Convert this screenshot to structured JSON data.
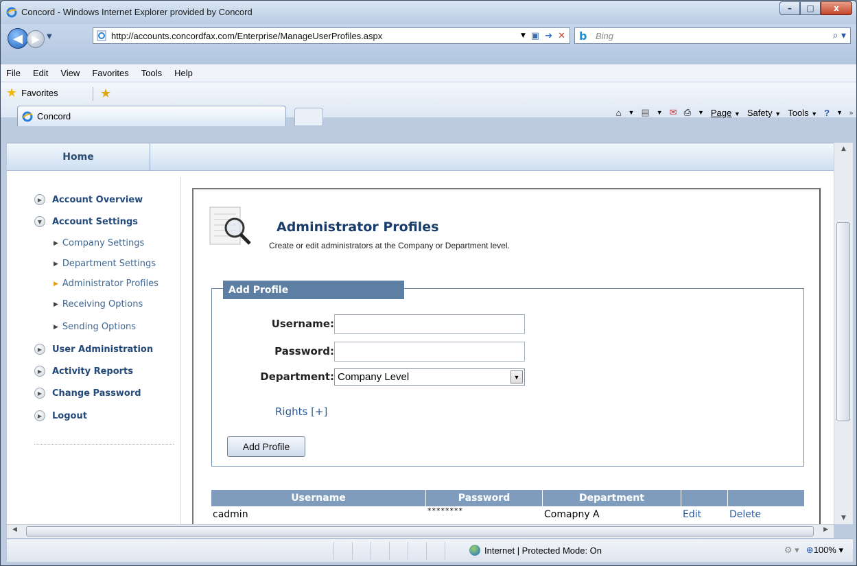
{
  "window": {
    "title": "Concord - Windows Internet Explorer provided by Concord",
    "controls": [
      "–",
      "□",
      "x"
    ]
  },
  "address": {
    "url": "http://accounts.concordfax.com/Enterprise/ManageUserProfiles.aspx",
    "search_placeholder": "Bing"
  },
  "menu": [
    "File",
    "Edit",
    "View",
    "Favorites",
    "Tools",
    "Help"
  ],
  "favorites": {
    "label": "Favorites"
  },
  "tab": {
    "label": "Concord"
  },
  "commandbar": {
    "page": "Page",
    "safety": "Safety",
    "tools": "Tools"
  },
  "page": {
    "home_tab": "Home",
    "sidebar": {
      "account_overview": "Account Overview",
      "account_settings": "Account Settings",
      "company_settings": "Company Settings",
      "department_settings": "Department Settings",
      "administrator_profiles": "Administrator Profiles",
      "receiving_options": "Receiving Options",
      "sending_options": "Sending Options",
      "user_administration": "User Administration",
      "activity_reports": "Activity Reports",
      "change_password": "Change Password",
      "logout": "Logout"
    },
    "header": {
      "title": "Administrator Profiles",
      "subtitle": "Create or edit administrators at the Company or Department level."
    },
    "form": {
      "legend": "Add Profile",
      "username_label": "Username:",
      "password_label": "Password:",
      "department_label": "Department:",
      "department_value": "Company Level",
      "rights_link": "Rights [+]",
      "add_button": "Add Profile"
    },
    "table": {
      "headers": [
        "Username",
        "Password",
        "Department",
        "",
        ""
      ],
      "rows": [
        {
          "username": "cadmin",
          "password": "********",
          "department": "Comapny A",
          "edit": "Edit",
          "delete": "Delete"
        }
      ]
    }
  },
  "status": {
    "zone": "Internet | Protected Mode: On",
    "zoom": "100%"
  }
}
